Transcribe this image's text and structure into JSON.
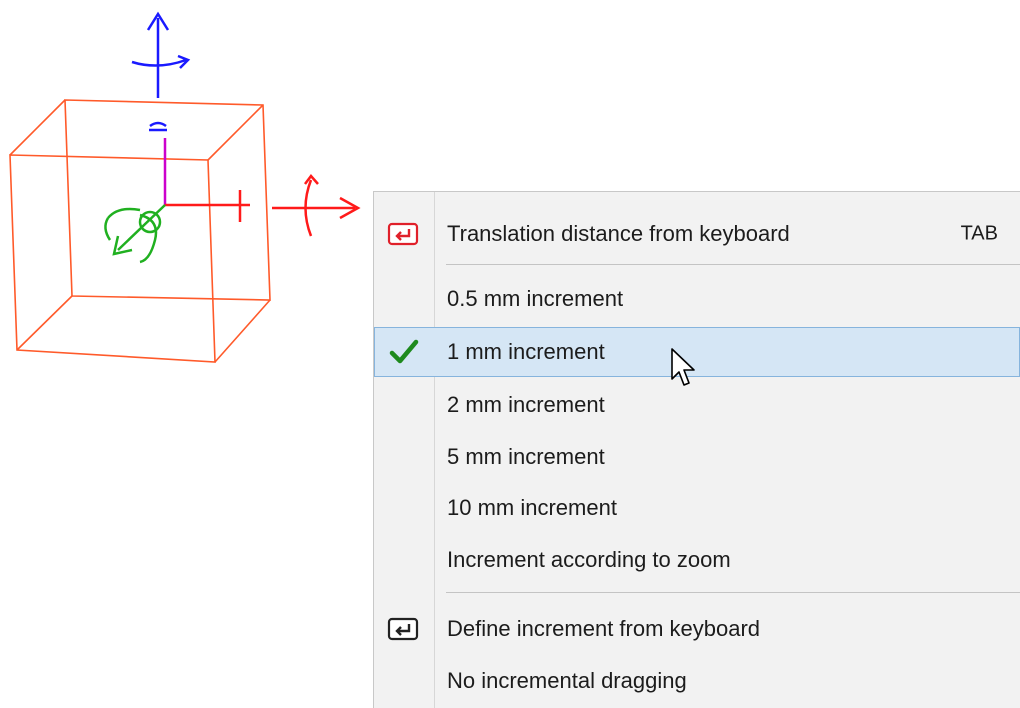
{
  "menu": {
    "items": [
      {
        "label": "Translation distance from keyboard",
        "shortcut": "TAB",
        "icon": "keyboard-enter-red-icon"
      },
      {
        "label": "0.5 mm increment"
      },
      {
        "label": "1 mm increment",
        "checked": true,
        "hovered": true,
        "icon": "checkmark-icon"
      },
      {
        "label": "2 mm increment"
      },
      {
        "label": "5 mm increment"
      },
      {
        "label": "10 mm increment"
      },
      {
        "label": "Increment according to zoom"
      },
      {
        "label": "Define increment from keyboard",
        "icon": "keyboard-enter-icon"
      },
      {
        "label": "No incremental dragging"
      }
    ]
  },
  "viewport": {
    "object": "wireframe-box",
    "manipulator_colors": {
      "x_axis": "#ff1a1a",
      "y_axis": "#1a1aff",
      "z_axis": "#cc00cc",
      "rotation": "#20b020",
      "box": "#ff5a2a"
    }
  },
  "colors": {
    "hover_bg": "#d5e6f5",
    "hover_border": "#86b4dd",
    "menu_bg": "#f2f2f2",
    "check": "#1e8a1e"
  }
}
